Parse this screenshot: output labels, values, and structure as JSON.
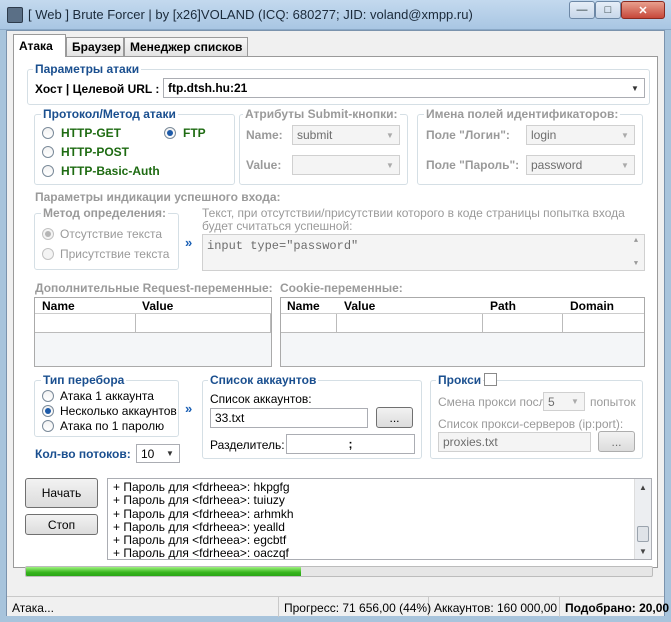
{
  "window": {
    "title": "[ Web ] Brute Forcer | by [x26]VOLAND (ICQ: 680277; JID: voland@xmpp.ru)"
  },
  "tabs": [
    "Атака",
    "Браузер",
    "Менеджер списков"
  ],
  "attack_params": {
    "title": "Параметры атаки",
    "host_label": "Хост | Целевой URL :",
    "host_value": "ftp.dtsh.hu:21"
  },
  "protocol": {
    "title": "Протокол/Метод атаки",
    "options": [
      "HTTP-GET",
      "HTTP-POST",
      "HTTP-Basic-Auth",
      "FTP"
    ],
    "selected": "FTP"
  },
  "submit_attrs": {
    "title": "Атрибуты Submit-кнопки:",
    "name_label": "Name:",
    "name_value": "submit",
    "value_label": "Value:",
    "value_value": ""
  },
  "id_fields": {
    "title": "Имена полей идентификаторов:",
    "login_label": "Поле \"Логин\":",
    "login_value": "login",
    "password_label": "Поле \"Пароль\":",
    "password_value": "password"
  },
  "success": {
    "title": "Параметры индикации успешного входа:",
    "method_title": "Метод определения:",
    "options": [
      "Отсутствие текста",
      "Присутствие текста"
    ],
    "selected": "Отсутствие текста",
    "desc": "Текст, при отсутствии/присутствии которого в коде страницы попытка входа будет считаться успешной:",
    "text_value": "input type=\"password\"",
    "arrow": "»"
  },
  "request_vars": {
    "title": "Дополнительные Request-переменные:",
    "columns": [
      "Name",
      "Value"
    ]
  },
  "cookie_vars": {
    "title": "Cookie-переменные:",
    "columns": [
      "Name",
      "Value",
      "Path",
      "Domain"
    ]
  },
  "enum_type": {
    "title": "Тип перебора",
    "options": [
      "Атака 1 аккаунта",
      "Несколько аккаунтов",
      "Атака по 1 паролю"
    ],
    "selected": "Несколько аккаунтов",
    "arrow": "»"
  },
  "threads": {
    "label": "Кол-во потоков:",
    "value": "10"
  },
  "accounts": {
    "title": "Список аккаунтов",
    "list_label": "Список аккаунтов:",
    "list_value": "33.txt",
    "browse": "...",
    "sep_label": "Разделитель:",
    "sep_value": ";"
  },
  "proxy": {
    "title": "Прокси",
    "change_label": "Смена прокси после",
    "change_value": "5",
    "change_unit": "попыток",
    "servers_label": "Список прокси-серверов (ip:port):",
    "servers_value": "proxies.txt",
    "browse": "..."
  },
  "controls": {
    "start": "Начать",
    "stop": "Стоп"
  },
  "log": [
    "+ Пароль для <fdrheea>: hkpgfg",
    "+ Пароль для <fdrheea>: tuiuzy",
    "+ Пароль для <fdrheea>: arhmkh",
    "+ Пароль для <fdrheea>: yealld",
    "+ Пароль для <fdrheea>: egcbtf",
    "+ Пароль для <fdrheea>: oaczqf"
  ],
  "progress_fraction": 0.44,
  "status": {
    "state": "Атака...",
    "progress": "Прогресс: 71 656,00 (44%)",
    "accounts": "Аккаунтов: 160 000,00",
    "found": "Подобрано: 20,00"
  }
}
